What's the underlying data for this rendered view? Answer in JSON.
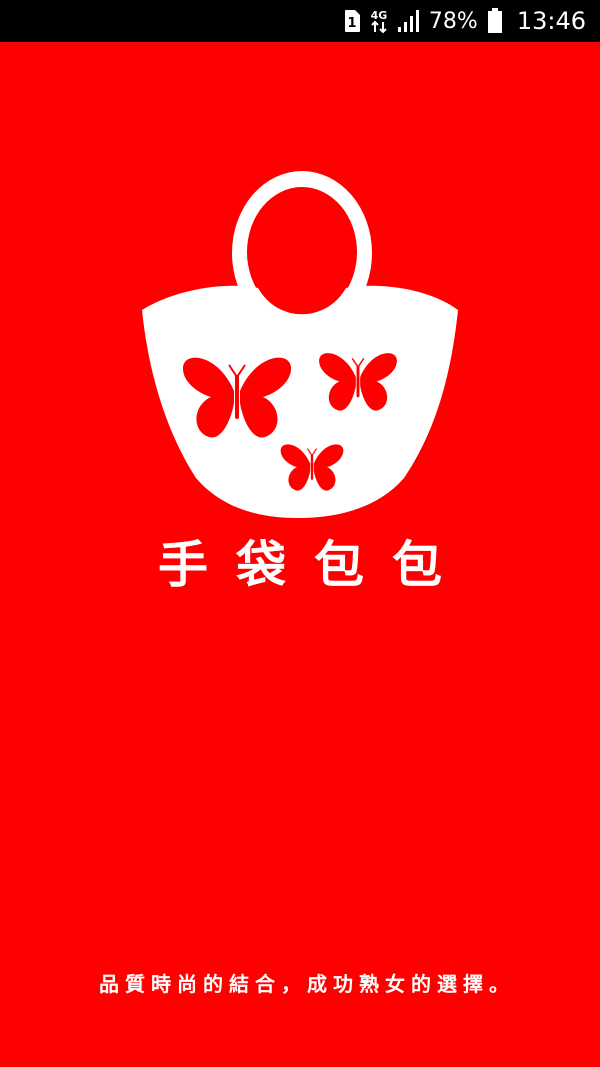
{
  "status_bar": {
    "sim_slot": "1",
    "network_type": "4G",
    "battery_percent": "78%",
    "time": "13:46",
    "icons": [
      "sim-icon",
      "network-icon",
      "signal-icon",
      "battery-icon"
    ]
  },
  "splash": {
    "logo": "handbag-butterfly-logo",
    "title": "手袋包包",
    "slogan": "品質時尚的結合，成功熟女的選擇。"
  },
  "colors": {
    "background": "#ff0000",
    "status_bar": "#000000",
    "foreground": "#ffffff"
  }
}
